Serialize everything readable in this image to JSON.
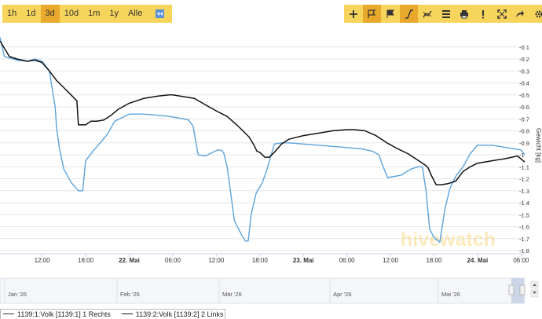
{
  "toolbar": {
    "ranges": [
      "1h",
      "1d",
      "3d",
      "10d",
      "1m",
      "1y",
      "Alle"
    ],
    "active_range": "3d",
    "icons": [
      "plus-icon",
      "flag-outline-icon",
      "flag-icon",
      "line-draw-icon",
      "line-chart-icon",
      "list-icon",
      "print-icon",
      "exclamation-icon",
      "fullscreen-icon",
      "share-icon",
      "gear-icon"
    ],
    "active_icons": [
      "flag-outline-icon",
      "line-draw-icon"
    ]
  },
  "watermark": "hivewatch",
  "colors": {
    "series1": "#5ba3dc",
    "series2": "#111111",
    "accent": "#f7d55c",
    "accent_active": "#e8a92c"
  },
  "chart_data": {
    "type": "line",
    "ylabel": "Gewicht [kg]",
    "ylim": [
      -1.8,
      0
    ],
    "yticks": [
      -0.1,
      -0.2,
      -0.3,
      -0.4,
      -0.5,
      -0.6,
      -0.7,
      -0.8,
      -0.9,
      -1,
      -1.1,
      -1.2,
      -1.3,
      -1.4,
      -1.5,
      -1.6,
      -1.7,
      -1.8
    ],
    "ytick_labels": [
      "-0.1",
      "-0.2",
      "-0.3",
      "-0.4",
      "-0.5",
      "-0.6",
      "-0.7",
      "-0.8",
      "-0.9",
      "-1",
      "-1.1",
      "-1.2",
      "-1.3",
      "-1.4",
      "-1.5",
      "-1.6",
      "-1.7",
      "-1.8"
    ],
    "xlim": [
      6.2,
      78.5
    ],
    "xticks": [
      12,
      18,
      24,
      30,
      36,
      42,
      48,
      54,
      60,
      66,
      72,
      78
    ],
    "xtick_labels": [
      "12:00",
      "18:00",
      "22. Mai",
      "06:00",
      "12:00",
      "18:00",
      "23. Mai",
      "06:00",
      "12:00",
      "18:00",
      "24. Mai",
      "06:00"
    ],
    "grid": true,
    "series": [
      {
        "name": "1139:1:Volk [1139:1] 1 Rechts",
        "x": [
          6.2,
          6.8,
          7.4,
          8.5,
          10,
          11,
          12,
          13,
          13.8,
          14,
          14.4,
          15,
          16,
          17,
          17.6,
          18,
          19,
          20,
          21,
          22,
          24,
          26,
          28,
          29.5,
          30.5,
          31.5,
          32.2,
          32.8,
          33.5,
          34.5,
          35.5,
          36.2,
          36.6,
          37,
          37.5,
          38.5,
          39.5,
          40,
          40.4,
          40.8,
          41.5,
          42.3,
          43,
          44,
          45,
          46,
          48,
          50,
          52,
          54,
          56,
          57.5,
          58.4,
          59,
          59.6,
          60.6,
          61.5,
          62.8,
          63.8,
          64.4,
          64.9,
          65.4,
          66,
          66.8,
          67.5,
          68.2,
          69,
          70,
          71,
          72,
          74,
          76,
          78,
          78.5
        ],
        "y": [
          -0.02,
          -0.18,
          -0.19,
          -0.21,
          -0.22,
          -0.2,
          -0.22,
          -0.3,
          -0.6,
          -0.78,
          -0.95,
          -1.12,
          -1.23,
          -1.3,
          -1.3,
          -1.05,
          -0.97,
          -0.9,
          -0.83,
          -0.72,
          -0.66,
          -0.66,
          -0.67,
          -0.68,
          -0.69,
          -0.7,
          -0.71,
          -0.76,
          -1,
          -1.01,
          -0.98,
          -0.96,
          -0.96,
          -0.98,
          -1.1,
          -1.55,
          -1.67,
          -1.72,
          -1.72,
          -1.5,
          -1.32,
          -1.24,
          -1.12,
          -0.91,
          -0.9,
          -0.9,
          -0.91,
          -0.92,
          -0.93,
          -0.94,
          -0.95,
          -0.97,
          -1,
          -1.1,
          -1.19,
          -1.18,
          -1.17,
          -1.12,
          -1.1,
          -1.1,
          -1.3,
          -1.62,
          -1.69,
          -1.73,
          -1.45,
          -1.28,
          -1.18,
          -1.1,
          -0.99,
          -0.92,
          -0.92,
          -0.94,
          -0.96,
          -1.0
        ]
      },
      {
        "name": "1139:2:Volk [1139:2] 2 Links",
        "x": [
          6.2,
          7.5,
          8.5,
          10,
          11,
          12,
          13,
          14,
          15,
          16,
          16.8,
          17,
          17.2,
          18,
          18.7,
          19.5,
          20.5,
          21.5,
          22.5,
          24,
          26,
          28,
          29.5,
          30,
          31,
          33,
          35,
          36.5,
          37.5,
          39,
          40.5,
          41.2,
          41.6,
          42,
          42.7,
          43.3,
          44,
          45,
          46,
          48,
          50,
          52,
          54,
          55,
          56.5,
          58,
          59.5,
          61,
          62.4,
          63.4,
          63.9,
          64.4,
          64.9,
          65.2,
          65.7,
          66.3,
          67,
          68,
          69,
          70,
          71,
          72,
          74,
          76,
          77.5,
          78.5
        ],
        "y": [
          -0.05,
          -0.18,
          -0.2,
          -0.22,
          -0.21,
          -0.23,
          -0.3,
          -0.38,
          -0.44,
          -0.5,
          -0.55,
          -0.75,
          -0.75,
          -0.75,
          -0.72,
          -0.72,
          -0.71,
          -0.67,
          -0.62,
          -0.57,
          -0.53,
          -0.51,
          -0.5,
          -0.5,
          -0.51,
          -0.53,
          -0.6,
          -0.65,
          -0.68,
          -0.76,
          -0.85,
          -0.92,
          -0.97,
          -0.98,
          -1.02,
          -1.02,
          -0.98,
          -0.91,
          -0.87,
          -0.84,
          -0.82,
          -0.8,
          -0.79,
          -0.79,
          -0.8,
          -0.84,
          -0.9,
          -0.95,
          -0.99,
          -1.03,
          -1.05,
          -1.07,
          -1.09,
          -1.11,
          -1.18,
          -1.25,
          -1.25,
          -1.24,
          -1.22,
          -1.14,
          -1.1,
          -1.07,
          -1.05,
          -1.03,
          -1.01,
          -1.06
        ]
      }
    ]
  },
  "navigator": {
    "labels": [
      "Jan '26",
      "Feb '26",
      "Mär '26",
      "Apr '26",
      "Mai '26"
    ]
  }
}
